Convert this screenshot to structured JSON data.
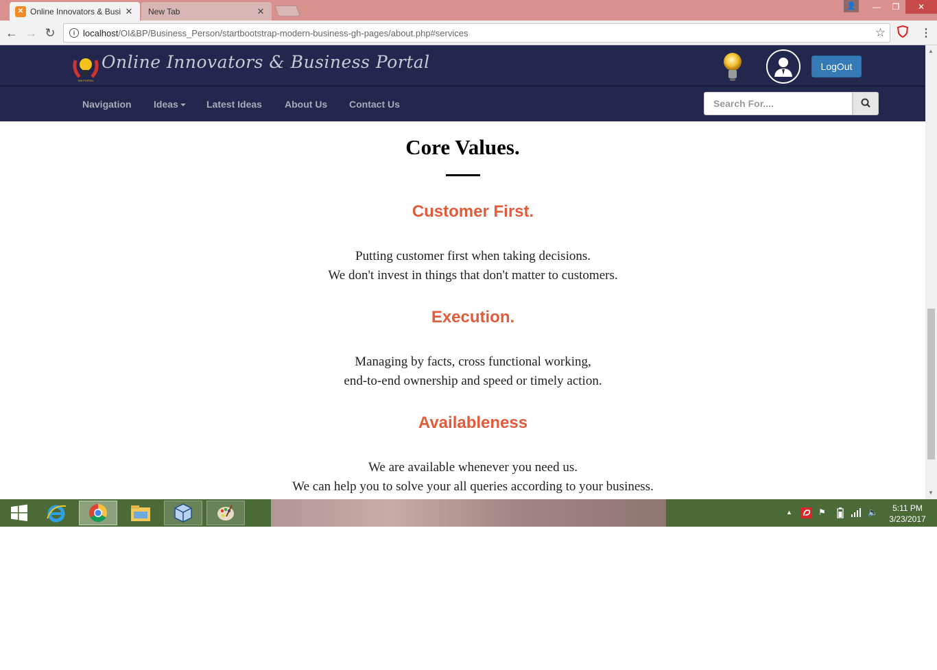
{
  "browser": {
    "tabs": [
      {
        "title": "Online Innovators & Busi",
        "active": true
      },
      {
        "title": "New Tab",
        "active": false
      }
    ],
    "url_host": "localhost",
    "url_path": "/OI&BP/Business_Person/startbootstrap-modern-business-gh-pages/about.php#services"
  },
  "site": {
    "brand": "Online Innovators & Business Portal",
    "logo_caption": "OIB PORTAL",
    "logout_label": "LogOut",
    "nav": [
      {
        "label": "Navigation"
      },
      {
        "label": "Ideas"
      },
      {
        "label": "Latest Ideas"
      },
      {
        "label": "About Us"
      },
      {
        "label": "Contact Us"
      }
    ],
    "search_placeholder": "Search For...."
  },
  "content": {
    "title": "Core Values.",
    "values": [
      {
        "heading": "Customer First.",
        "line1": "Putting customer first when taking decisions.",
        "line2": "We don't invest in things that don't matter to customers."
      },
      {
        "heading": "Execution.",
        "line1": "Managing by facts, cross functional working,",
        "line2": "end-to-end ownership and speed or timely action."
      },
      {
        "heading": "Availableness",
        "line1": "We are available whenever you need us.",
        "line2": "We can help you to solve your all queries according to your business."
      }
    ]
  },
  "taskbar": {
    "time": "5:11 PM",
    "date": "3/23/2017",
    "apps": [
      "windows-start",
      "internet-explorer",
      "chrome",
      "file-explorer",
      "virtualbox",
      "paint"
    ]
  },
  "colors": {
    "header_bg": "#23264d",
    "accent": "#e25b3b",
    "logout_bg": "#337ab7",
    "taskbar": "#4a6b38"
  }
}
